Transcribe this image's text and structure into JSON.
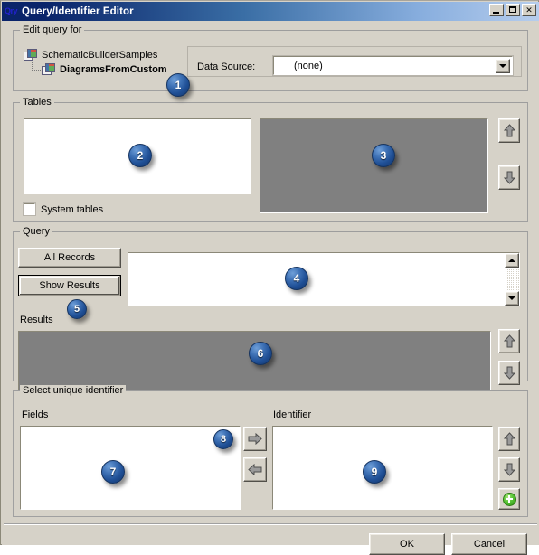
{
  "window": {
    "title": "Query/Identifier Editor",
    "icon": "query-editor-icon",
    "minimize_label": "",
    "maximize_label": "",
    "close_label": "✕"
  },
  "edit_query_group": {
    "legend": "Edit query for",
    "tree": {
      "root": {
        "label": "SchematicBuilderSamples",
        "icon": "database-table-icon"
      },
      "child": {
        "label": "DiagramsFromCustom",
        "icon": "database-table-icon",
        "bold": true
      }
    },
    "data_source": {
      "label": "Data Source:",
      "value": "(none)",
      "options": [
        "(none)"
      ],
      "dropdown_icon": "chevron-down-icon"
    },
    "badge": "1"
  },
  "tables_group": {
    "legend": "Tables",
    "available_list": {
      "items": [],
      "badge": "2"
    },
    "selected_list": {
      "items": [],
      "badge": "3",
      "disabled": true
    },
    "system_tables_checkbox": {
      "label": "System tables",
      "checked": false
    },
    "move_up_icon": "arrow-up-icon",
    "move_down_icon": "arrow-down-icon"
  },
  "query_group": {
    "legend": "Query",
    "all_records_button": "All Records",
    "show_results_button": "Show Results",
    "show_results_badge": "5",
    "query_text": {
      "value": "",
      "badge": "4"
    },
    "results_label": "Results",
    "results_list": {
      "items": [],
      "badge": "6",
      "disabled": true
    },
    "scroll_up_icon": "scroll-up-icon",
    "scroll_down_icon": "scroll-down-icon",
    "results_up_icon": "arrow-up-icon",
    "results_down_icon": "arrow-down-icon"
  },
  "identifier_group": {
    "legend": "Select unique identifier",
    "fields_label": "Fields",
    "fields_list": {
      "items": [],
      "badge": "7"
    },
    "identifier_label": "Identifier",
    "identifier_list": {
      "items": [],
      "badge": "9"
    },
    "move_right_icon": "arrow-right-icon",
    "move_left_icon": "arrow-left-icon",
    "transfer_badge": "8",
    "order_up_icon": "arrow-up-icon",
    "order_down_icon": "arrow-down-icon",
    "add_icon": "green-plus-icon"
  },
  "footer": {
    "ok_label": "OK",
    "cancel_label": "Cancel"
  },
  "colors": {
    "dialog_face": "#d6d2c8",
    "titlebar_start": "#0a246a",
    "titlebar_end": "#b6cded",
    "disabled_list": "#808080",
    "badge_blue": "#1f4f95",
    "accent_green": "#57c336"
  }
}
